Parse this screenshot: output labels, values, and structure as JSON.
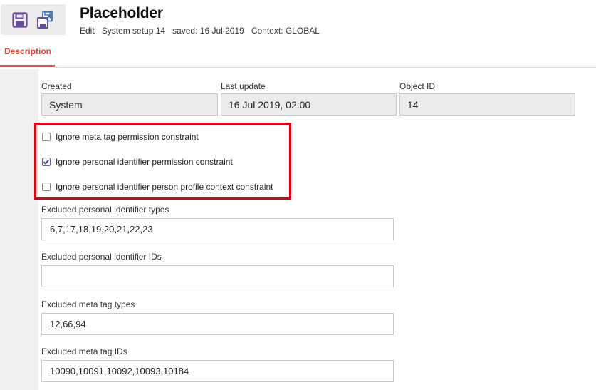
{
  "header": {
    "title": "Placeholder",
    "meta": {
      "mode": "Edit",
      "setup": "System setup 14",
      "saved": "saved: 16 Jul 2019",
      "context": "Context: GLOBAL"
    }
  },
  "toolbar": {
    "save_icon": "save-icon",
    "save_as_icon": "save-as-icon"
  },
  "tabs": [
    {
      "label": "Description",
      "active": true
    }
  ],
  "info": {
    "created_label": "Created",
    "created_value": "System",
    "last_update_label": "Last update",
    "last_update_value": "16 Jul 2019, 02:00",
    "object_id_label": "Object ID",
    "object_id_value": "14"
  },
  "checkboxes": [
    {
      "label": "Ignore meta tag permission constraint",
      "checked": false
    },
    {
      "label": "Ignore personal identifier permission constraint",
      "checked": true
    },
    {
      "label": "Ignore personal identifier person profile context constraint",
      "checked": false
    }
  ],
  "fields": [
    {
      "label": "Excluded personal identifier types",
      "value": "6,7,17,18,19,20,21,22,23"
    },
    {
      "label": "Excluded personal identifier IDs",
      "value": ""
    },
    {
      "label": "Excluded meta tag types",
      "value": "12,66,94"
    },
    {
      "label": "Excluded meta tag IDs",
      "value": "10090,10091,10092,10093,10184"
    }
  ],
  "colors": {
    "accent": "#e5473b",
    "highlight": "#e3000f",
    "icon": "#6a4c9c"
  }
}
